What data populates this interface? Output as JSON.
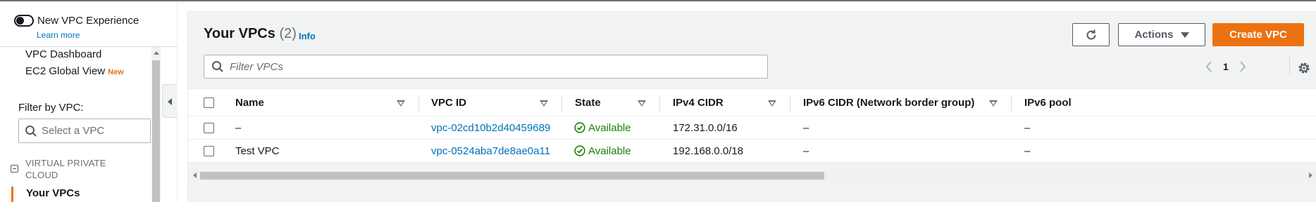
{
  "sidebar": {
    "toggle_label": "New VPC Experience",
    "learn_more": "Learn more",
    "items": [
      {
        "label": "VPC Dashboard"
      },
      {
        "label": "EC2 Global View",
        "badge": "New"
      }
    ],
    "filter_label": "Filter by VPC:",
    "filter_placeholder": "Select a VPC",
    "section_title": "VIRTUAL PRIVATE CLOUD",
    "active_item": "Your VPCs"
  },
  "header": {
    "title": "Your VPCs",
    "count": "(2)",
    "info": "Info",
    "actions_label": "Actions",
    "create_label": "Create VPC"
  },
  "search": {
    "placeholder": "Filter VPCs"
  },
  "pagination": {
    "page": "1"
  },
  "table": {
    "columns": [
      "Name",
      "VPC ID",
      "State",
      "IPv4 CIDR",
      "IPv6 CIDR (Network border group)",
      "IPv6 pool"
    ],
    "rows": [
      {
        "name": "–",
        "vpc_id": "vpc-02cd10b2d40459689",
        "state": "Available",
        "ipv4": "172.31.0.0/16",
        "ipv6": "–",
        "pool": "–"
      },
      {
        "name": "Test VPC",
        "vpc_id": "vpc-0524aba7de8ae0a11",
        "state": "Available",
        "ipv4": "192.168.0.0/18",
        "ipv6": "–",
        "pool": "–"
      }
    ]
  },
  "colors": {
    "accent": "#ec7211",
    "link": "#0073bb",
    "success": "#1d8102"
  },
  "icons": [
    "toggle-switch",
    "search-icon",
    "collapse-icon",
    "refresh-icon",
    "caret-down-icon",
    "chevron-left-icon",
    "chevron-right-icon",
    "gear-icon",
    "sort-icon",
    "check-circle-icon"
  ]
}
